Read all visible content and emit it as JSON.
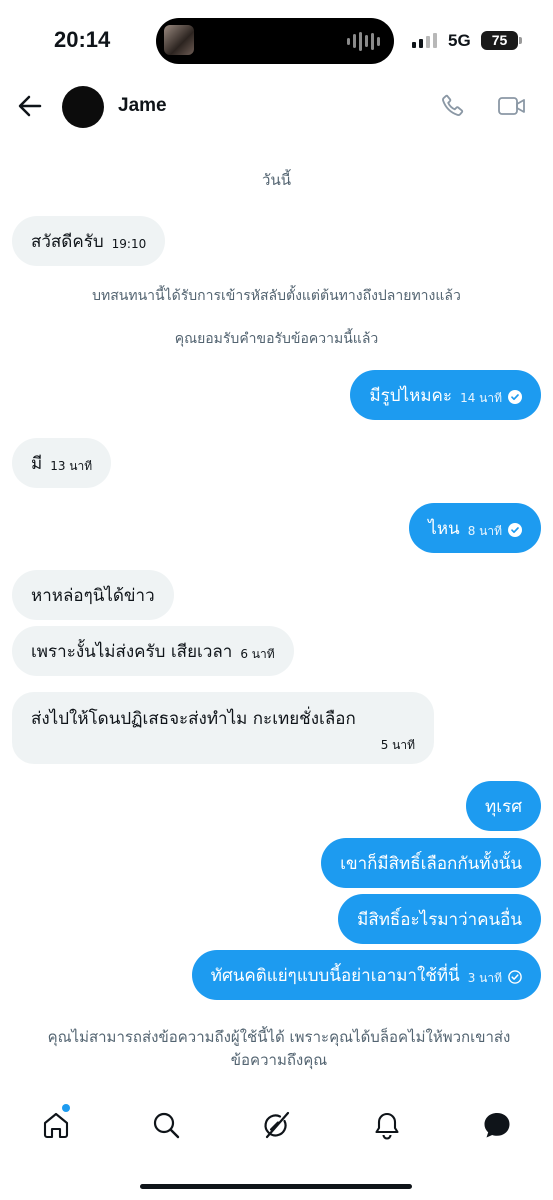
{
  "status_bar": {
    "time": "20:14",
    "network": "5G",
    "battery": "75"
  },
  "header": {
    "contact_name": "Jame",
    "icons": [
      "back-arrow-icon",
      "phone-icon",
      "video-icon"
    ]
  },
  "conversation": {
    "date_label": "วันนี้",
    "messages": [
      {
        "dir": "in",
        "text": "สวัสดีครับ",
        "time": "19:10"
      },
      {
        "dir": "out",
        "text": "มีรูปไหมคะ",
        "time": "14 นาที",
        "status": "read"
      },
      {
        "dir": "in",
        "text": "มี",
        "time": "13 นาที"
      },
      {
        "dir": "out",
        "text": "ไหน",
        "time": "8 นาที",
        "status": "read"
      },
      {
        "dir": "in",
        "text": "หาหล่อๆนิได้ข่าว",
        "time": ""
      },
      {
        "dir": "in",
        "text": "เพราะงั้นไม่ส่งครับ เสียเวลา",
        "time": "6 นาที"
      },
      {
        "dir": "in",
        "text": "ส่งไปให้โดนปฏิเสธจะส่งทำไม กะเทยชั่งเลือก",
        "time": "5 นาที"
      },
      {
        "dir": "out",
        "text": "ทุเรศ",
        "time": ""
      },
      {
        "dir": "out",
        "text": "เขาก็มีสิทธิ์เลือกกันทั้งนั้น",
        "time": ""
      },
      {
        "dir": "out",
        "text": "มีสิทธิ์อะไรมาว่าคนอื่น",
        "time": ""
      },
      {
        "dir": "out",
        "text": "ทัศนคติแย่ๆแบบนี้อย่าเอามาใช้ที่นี่",
        "time": "3 นาที",
        "status": "sent"
      }
    ],
    "system_notes": [
      "บทสนทนานี้ได้รับการเข้ารหัสลับตั้งแต่ต้นทางถึงปลายทางแล้ว",
      "คุณยอมรับคำขอรับข้อความนี้แล้ว"
    ],
    "blocked_notice": "คุณไม่สามารถส่งข้อความถึงผู้ใช้นี้ได้ เพราะคุณได้บล็อคไม่ให้พวกเขาส่งข้อความถึงคุณ"
  },
  "bottom_nav": {
    "items": [
      "home-icon",
      "search-icon",
      "grok-icon",
      "notifications-icon",
      "messages-icon"
    ],
    "active": "messages-icon"
  },
  "colors": {
    "accent": "#1d9bf0",
    "incoming_bubble": "#eff3f4",
    "secondary_text": "#536471"
  }
}
